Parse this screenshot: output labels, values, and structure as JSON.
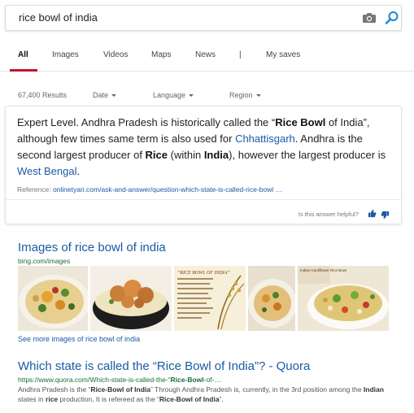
{
  "search": {
    "query": "rice bowl of india"
  },
  "tabs": [
    {
      "label": "All",
      "active": true
    },
    {
      "label": "Images"
    },
    {
      "label": "Videos"
    },
    {
      "label": "Maps"
    },
    {
      "label": "News"
    },
    {
      "label": "|"
    },
    {
      "label": "My saves"
    }
  ],
  "filters": {
    "results_count": "67,400 Results",
    "date": "Date",
    "language": "Language",
    "region": "Region"
  },
  "answer": {
    "s1": "Expert Level. Andhra Pradesh is historically called the “",
    "b1": "Rice Bowl",
    "s2": " of India”, although few times same term is also used for ",
    "l1": "Chhattisgarh",
    "s3": ". Andhra is the second largest producer of ",
    "b2": "Rice",
    "s4": " (within ",
    "b3": "India",
    "s5": "), however the largest producer is ",
    "l2": "West Bengal",
    "s6": ".",
    "reference_label": "Reference: ",
    "reference_link": "onlinetyari.com/ask-and-answer/question-which-state-is-called-rice-bowl …",
    "helpful_label": "Is this answer helpful?"
  },
  "images_section": {
    "title": "Images of rice bowl of india",
    "source": "bing.com/images",
    "see_more": "See more images of rice bowl of india",
    "thumb3_caption": "“RICE BOWL OF INDIA”",
    "thumb5_caption": "Indian Cauliflower Rice Bowl"
  },
  "result": {
    "title": "Which state is called the “Rice Bowl of India”? - Quora",
    "url_1": "https://www.quora.com/Which-state-is-called-the-“",
    "url_2": "Rice-Bowl",
    "url_3": "-of-…",
    "sn_1": "Andhra Pradesh is the “",
    "sn_2": "Rice-Bowl of India",
    "sn_3": "” Through Andhra Pradesh is, currently, in the 3rd position among the ",
    "sn_4": "Indian",
    "sn_5": " states in ",
    "sn_6": "rice",
    "sn_7": " production, It is refereed as the “",
    "sn_8": "Rice-Bowl of India",
    "sn_9": "”."
  },
  "colors": {
    "accent": "#c8102e",
    "link": "#1a5aa6",
    "url_green": "#186e3a"
  }
}
